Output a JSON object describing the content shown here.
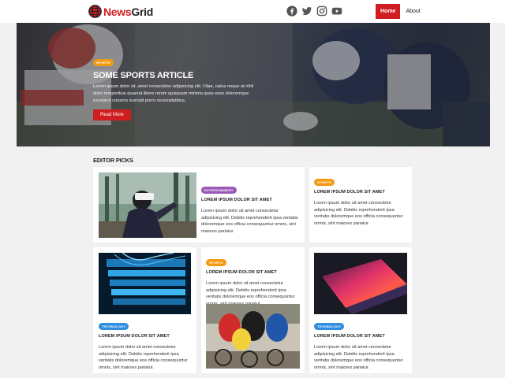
{
  "nav": {
    "brand_part1": "News",
    "brand_part2": "Grid",
    "home_label": "Home",
    "about_label": "About"
  },
  "hero": {
    "badge": "SPORTS",
    "title": "SOME SPORTS ARTICLE",
    "text": "Lorem ipsum dolor sit, amet consectetur adipisicing elit. Vitae, natus neque at nihil dolor temporibus quaerat libero rerum quisquam minima quos esse doloremque excepturi corporis suscipit porro necessitatibus.",
    "button": "Read More"
  },
  "editor_picks": {
    "heading": "EDITOR PICKS",
    "cards": [
      {
        "badge": "ENTERTAINMENT",
        "title": "LOREM IPSUM DOLOR SIT AMET",
        "text": "Lorem ipsum dolor sit amet consectetur adipisicing elit. Debitis reprehenderit ipsa veritatis doloremque eos officia consequuntur omnis, sint maiores pariatur."
      },
      {
        "badge": "SPORTS",
        "title": "LOREM IPSUM DOLOR SIT AMET",
        "text": "Lorem ipsum dolor sit amet consectetur adipisicing elit. Debitis reprehenderit ipsa veritatis doloremque eos officia consequuntur omnis, sint maiores pariatur."
      },
      {
        "badge": "TECHNOLOGY",
        "title": "LOREM IPSUM DOLOR SIT AMET",
        "text": "Lorem ipsum dolor sit amet consectetur adipisicing elit. Debitis reprehenderit ipsa veritatis doloremque eos officia consequuntur omnis, sint maiores pariatur."
      },
      {
        "badge": "SPORTS",
        "title": "LOREM IPSUM DOLOR SIT AMET",
        "text": "Lorem ipsum dolor sit amet consectetur adipisicing elit. Debitis reprehenderit ipsa veritatis doloremque eos officia consequuntur omnis, sint maiores pariatur."
      },
      {
        "badge": "TECHNOLOGY",
        "title": "LOREM IPSUM DOLOR SIT AMET",
        "text": "Lorem ipsum dolor sit amet consectetur adipisicing elit. Debitis reprehenderit ipsa veritatis doloremque eos officia consequuntur omnis, sint maiores pariatur."
      }
    ]
  },
  "colors": {
    "brand_red": "#d01d20",
    "sports_badge": "#f39a12",
    "entertainment_badge": "#9b59b6",
    "technology_badge": "#2f8ee0"
  },
  "icons": [
    "globe-icon",
    "facebook-icon",
    "twitter-icon",
    "instagram-icon",
    "youtube-icon"
  ]
}
